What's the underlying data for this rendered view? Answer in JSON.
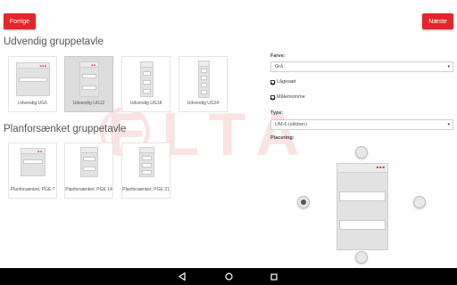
{
  "header": {
    "prev_label": "Forrige",
    "next_label": "Næste"
  },
  "watermark": "ELTA",
  "section_outdoor": {
    "title": "Udvendig gruppetavle",
    "items": [
      {
        "label": "Udvendig UG6"
      },
      {
        "label": "Udvendig UG12"
      },
      {
        "label": "Udvendig UG18"
      },
      {
        "label": "Udvendig UG24"
      }
    ]
  },
  "section_flush": {
    "title": "Planforsænket gruppetavle",
    "items": [
      {
        "label": "Planforsænket, PGE 7"
      },
      {
        "label": "Planforsænket, PGE 14"
      },
      {
        "label": "Planforsænket, PGE 21"
      }
    ]
  },
  "form": {
    "color_label": "Farve:",
    "color_value": "Grå",
    "checkbox_1": "Lågesæt",
    "checkbox_2": "Målemomme",
    "type_label": "Type:",
    "type_value": "UM-6 (stikben)",
    "placement_label": "Placering:"
  },
  "colors": {
    "accent": "#e3262b"
  },
  "icons": {
    "back": "triangle-back-icon",
    "home": "circle-home-icon",
    "recents": "square-recents-icon"
  }
}
